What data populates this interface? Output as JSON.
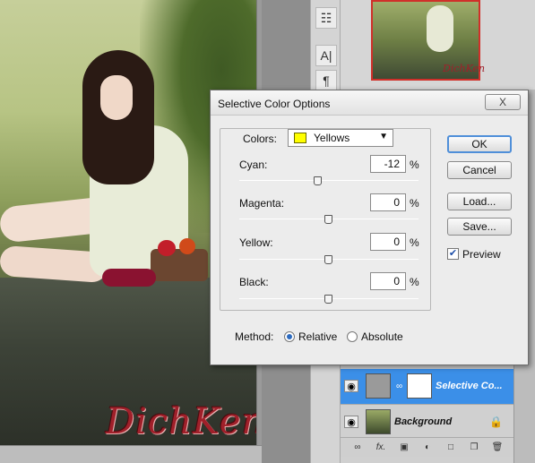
{
  "canvas": {
    "signature": "DichKen"
  },
  "navigator": {
    "signature": "DichKen"
  },
  "dialog": {
    "title": "Selective Color Options",
    "close_label": "X",
    "colors_label": "Colors:",
    "colors_selected": "Yellows",
    "swatch_color": "#ffff00",
    "sliders": [
      {
        "label": "Cyan:",
        "value": "-12",
        "unit": "%",
        "level": -12
      },
      {
        "label": "Magenta:",
        "value": "0",
        "unit": "%",
        "level": 0
      },
      {
        "label": "Yellow:",
        "value": "0",
        "unit": "%",
        "level": 0
      },
      {
        "label": "Black:",
        "value": "0",
        "unit": "%",
        "level": 0
      }
    ],
    "method_label": "Method:",
    "method_options": [
      "Relative",
      "Absolute"
    ],
    "method_selected": "Relative",
    "buttons": {
      "ok": "OK",
      "cancel": "Cancel",
      "load": "Load...",
      "save": "Save..."
    },
    "preview_label": "Preview",
    "preview_checked": true
  },
  "layers": {
    "items": [
      {
        "name": "Selective Co...",
        "selected": true
      },
      {
        "name": "Background",
        "selected": false,
        "locked": true
      }
    ],
    "selected_color": "#3b8fe8"
  },
  "icons": {
    "eye": "eye-icon",
    "lock": "lock-icon",
    "chain": "chain-icon"
  }
}
